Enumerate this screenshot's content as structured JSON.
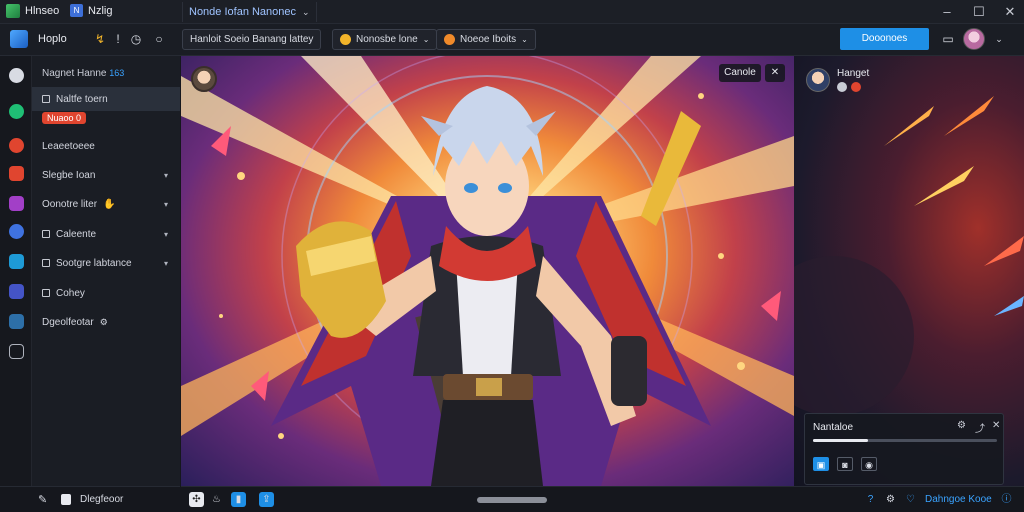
{
  "titlebar": {
    "app1_name": "Hlnseo",
    "app2_name": "Nzlig",
    "document_title": "Nonde Iofan Nanonec",
    "window_controls": [
      "minimize-icon",
      "maximize-icon",
      "close-icon"
    ]
  },
  "toolbar": {
    "app_name": "Hoplo",
    "pills": [
      {
        "label": "Hanloit Soeio Banang lattey"
      },
      {
        "label": "Nonosbe lone"
      },
      {
        "label": "Noeoe Iboits"
      }
    ],
    "primary_button": "Dooonoes"
  },
  "sidebar": {
    "header": "Nagnet Hanne",
    "header_tag": "163",
    "items": [
      {
        "label": "Naltfe toern",
        "active": true
      },
      {
        "label": "Nuaoo",
        "badge": "0"
      },
      {
        "label": "Leaeetoeee"
      },
      {
        "label": "Slegbe Ioan"
      },
      {
        "label": "Oonotre liter"
      },
      {
        "label": "Caleente"
      },
      {
        "label": "Sootgre labtance"
      },
      {
        "label": "Cohey"
      },
      {
        "label": "Dgeolfeotar"
      }
    ],
    "footer_label": "Dlegfeoor"
  },
  "canvas": {
    "overlay_button": "Canole",
    "overlay_icon": "close-icon"
  },
  "right_panel": {
    "user_name": "Hanget",
    "player": {
      "title": "Nantaloe",
      "progress": 0.3
    }
  },
  "bottombar": {
    "status_text": "Dahngoe Kooe"
  },
  "colors": {
    "accent": "#1e8fe6",
    "badge": "#e0452f",
    "sidebar_bg": "#1a1d24"
  }
}
